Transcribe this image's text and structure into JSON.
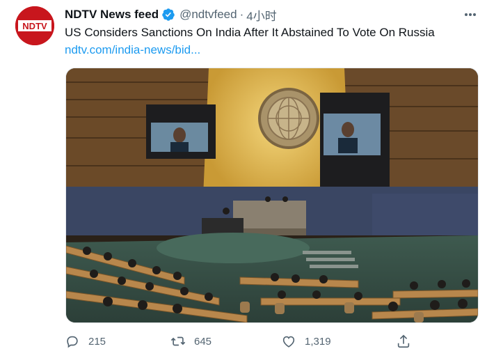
{
  "tweet": {
    "author_name": "NDTV News feed",
    "author_handle": "@ndtvfeed",
    "separator": "·",
    "timestamp": "4小时",
    "avatar_logo_text": "NDTV",
    "text": "US Considers Sanctions On India After It Abstained To Vote On Russia",
    "link": "ndtv.com/india-news/bid...",
    "media_description_icon": "photo"
  },
  "actions": {
    "reply_count": "215",
    "retweet_count": "645",
    "like_count": "1,319"
  },
  "colors": {
    "avatar_bg": "#c8161d",
    "verified_badge": "#1d9bf0",
    "link": "#1d9bf0",
    "secondary_text": "#536471"
  },
  "icons": {
    "verified": "verified-badge-icon",
    "more": "more-horizontal-icon",
    "reply": "reply-icon",
    "retweet": "retweet-icon",
    "like": "heart-icon",
    "share": "share-icon"
  }
}
